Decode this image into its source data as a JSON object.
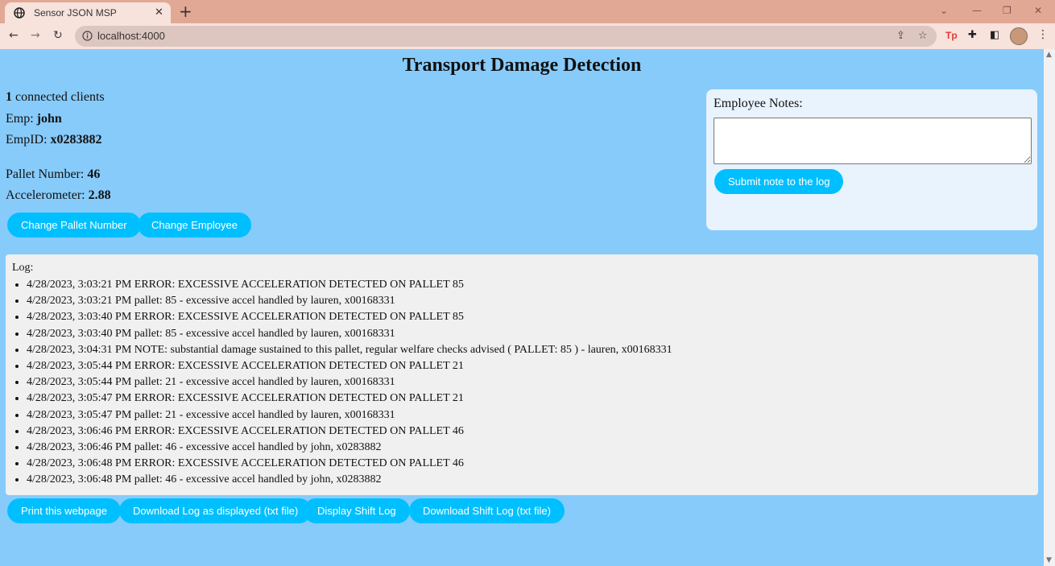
{
  "browser": {
    "tab_title": "Sensor JSON MSP",
    "url": "localhost:4000"
  },
  "page": {
    "title": "Transport Damage Detection",
    "clients_count": "1",
    "clients_label": " connected clients",
    "emp_label": "Emp: ",
    "emp_value": "john",
    "empid_label": "EmpID: ",
    "empid_value": "x0283882",
    "pallet_label": "Pallet Number: ",
    "pallet_value": "46",
    "accel_label": "Accelerometer: ",
    "accel_value": "2.88",
    "change_pallet_button": "Change Pallet Number",
    "change_employee_button": "Change Employee"
  },
  "notes": {
    "label": "Employee Notes:",
    "value": "",
    "submit_button": "Submit note to the log"
  },
  "log": {
    "label": "Log:",
    "entries": [
      "4/28/2023, 3:03:21 PM ERROR: EXCESSIVE ACCELERATION DETECTED ON PALLET 85",
      "4/28/2023, 3:03:21 PM pallet: 85 - excessive accel handled by lauren, x00168331",
      "4/28/2023, 3:03:40 PM ERROR: EXCESSIVE ACCELERATION DETECTED ON PALLET 85",
      "4/28/2023, 3:03:40 PM pallet: 85 - excessive accel handled by lauren, x00168331",
      "4/28/2023, 3:04:31 PM NOTE: substantial damage sustained to this pallet, regular welfare checks advised ( PALLET: 85 ) - lauren, x00168331",
      "4/28/2023, 3:05:44 PM ERROR: EXCESSIVE ACCELERATION DETECTED ON PALLET 21",
      "4/28/2023, 3:05:44 PM pallet: 21 - excessive accel handled by lauren, x00168331",
      "4/28/2023, 3:05:47 PM ERROR: EXCESSIVE ACCELERATION DETECTED ON PALLET 21",
      "4/28/2023, 3:05:47 PM pallet: 21 - excessive accel handled by lauren, x00168331",
      "4/28/2023, 3:06:46 PM ERROR: EXCESSIVE ACCELERATION DETECTED ON PALLET 46",
      "4/28/2023, 3:06:46 PM pallet: 46 - excessive accel handled by john, x0283882",
      "4/28/2023, 3:06:48 PM ERROR: EXCESSIVE ACCELERATION DETECTED ON PALLET 46",
      "4/28/2023, 3:06:48 PM pallet: 46 - excessive accel handled by john, x0283882"
    ]
  },
  "footer_buttons": {
    "print": "Print this webpage",
    "download_displayed": "Download Log as displayed (txt file)",
    "display_shift": "Display Shift Log",
    "download_shift": "Download Shift Log (txt file)"
  },
  "icons": {
    "favicon": "globe-icon",
    "tab_close": "close-icon",
    "new_tab": "plus-icon",
    "back": "arrow-left-icon",
    "forward": "arrow-right-icon",
    "reload": "reload-icon",
    "site_info": "info-icon",
    "share": "share-icon",
    "bookmark": "star-icon",
    "extensions": "puzzle-icon",
    "side_panel": "side-panel-icon",
    "profile": "avatar",
    "menu": "more-vert-icon"
  },
  "colors": {
    "page_background": "#87cbfb",
    "button": "#00bfff",
    "notes_panel": "#e8f3fe",
    "log_panel": "#f0f0f0",
    "tab_strip": "#e2a896"
  }
}
